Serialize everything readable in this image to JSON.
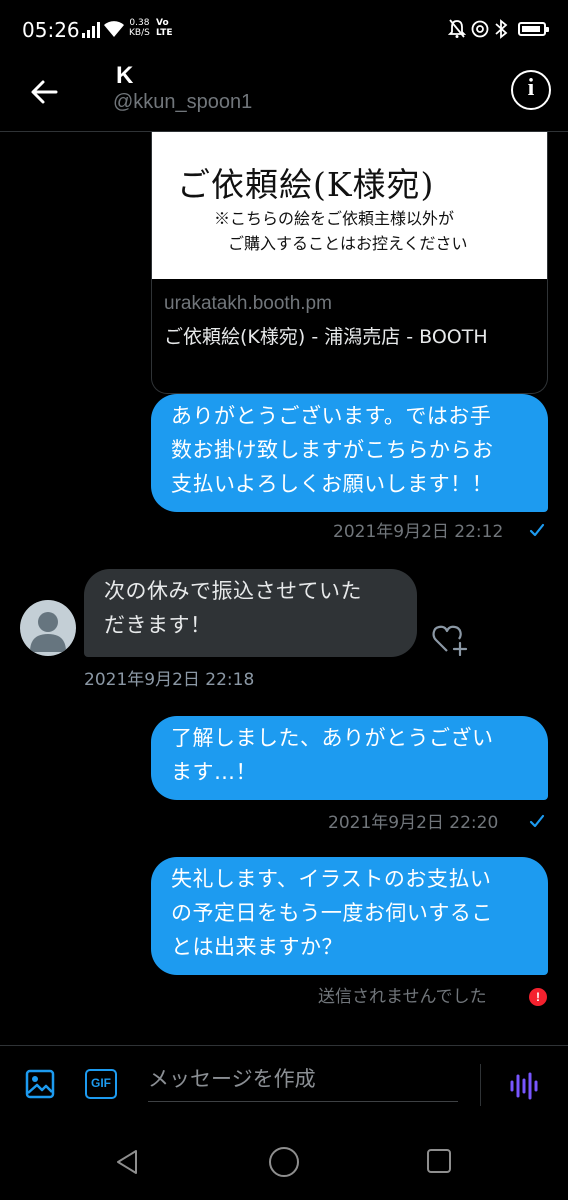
{
  "status_bar": {
    "time": "05:26",
    "net_speed": "0.38",
    "net_unit": "KB/S",
    "volte_top": "Vo",
    "volte_bottom": "LTE",
    "battery_level": 0.9
  },
  "header": {
    "name": "K",
    "handle": "@kkun_spoon1",
    "info_symbol": "i"
  },
  "link_card": {
    "image_title": "ご依頼絵(K様宛)",
    "image_note_line1": "※こちらの絵をご依頼主様以外が",
    "image_note_line2": "ご購入することはお控えください",
    "domain": "urakatakh.booth.pm",
    "title": "ご依頼絵(K様宛) - 浦潟売店 - BOOTH"
  },
  "messages": [
    {
      "direction": "sent",
      "text": "ありがとうございます。ではお手\n数お掛け致しますがこちらからお\n支払いよろしくお願いします！！",
      "time": "2021年9月2日 22:12",
      "status": "read"
    },
    {
      "direction": "received",
      "text": "次の休みで振込させていた\nだきます！",
      "time": "2021年9月2日 22:18"
    },
    {
      "direction": "sent",
      "text": "了解しました、ありがとうござい\nます…！",
      "time": "2021年9月2日 22:20",
      "status": "read"
    },
    {
      "direction": "sent",
      "text": "失礼します、イラストのお支払い\nの予定日をもう一度お伺いするこ\nとは出来ますか？",
      "status_text": "送信されませんでした",
      "status": "failed",
      "error_symbol": "!"
    }
  ],
  "composer": {
    "placeholder": "メッセージを作成",
    "gif_label": "GIF"
  },
  "colors": {
    "accent": "#1d9bf0",
    "received_bubble": "#2f3336",
    "error": "#f4212e",
    "background": "#000000"
  },
  "icons": {
    "back": "arrow-left-icon",
    "info": "info-icon",
    "image": "image-icon",
    "gif": "gif-icon",
    "voice": "voice-wave-icon",
    "like": "heart-plus-icon",
    "read": "check-icon",
    "error": "exclamation-icon"
  }
}
